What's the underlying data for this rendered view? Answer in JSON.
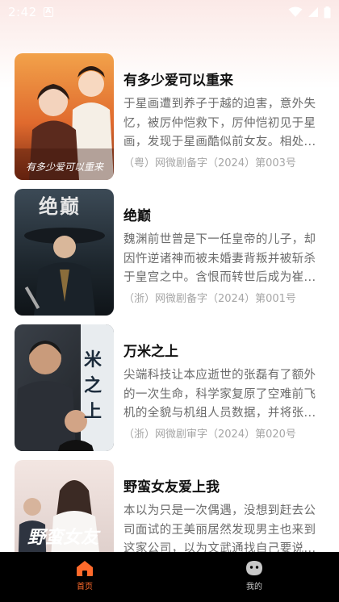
{
  "status_bar": {
    "time": "2:42",
    "notification_badge": "A"
  },
  "dramas": [
    {
      "title": "有多少爱可以重来",
      "description": "于星画遭到养子于越的迫害，意外失忆，被厉仲恺救下，厉仲恺初见于星画，发现于星画酷似前女友。相处...",
      "registration": "（粤）网微剧备字（2024）第003号",
      "poster_text": "有多少爱可以重来"
    },
    {
      "title": "绝巅",
      "description": "魏渊前世曾是下一任皇帝的儿子，却因忤逆诸神而被未婚妻背叛并被斩杀于皇宫之中。含恨而转世后成为崔...",
      "registration": "（浙）网微剧备字（2024）第001号",
      "poster_text": "绝巅"
    },
    {
      "title": "万米之上",
      "description": "尖端科技让本应逝世的张磊有了额外的一次生命，科学家复原了空难前飞机的全貌与机组人员数据，并将张...",
      "registration": "（浙）网微剧审字（2024）第020号",
      "poster_text": "米之上"
    },
    {
      "title": "野蛮女友爱上我",
      "description": "本以为只是一次偶遇，没想到赶去公司面试的王美丽居然发现男主也来到这家公司，以为文武通找自己要说...",
      "registration": "",
      "poster_text": "野蛮女友"
    }
  ],
  "bottom_nav": {
    "home": {
      "label": "首页",
      "icon": "home-icon",
      "color": "#ff6a2b"
    },
    "mine": {
      "label": "我的",
      "icon": "profile-face-icon",
      "color": "#c8c8c8"
    }
  }
}
